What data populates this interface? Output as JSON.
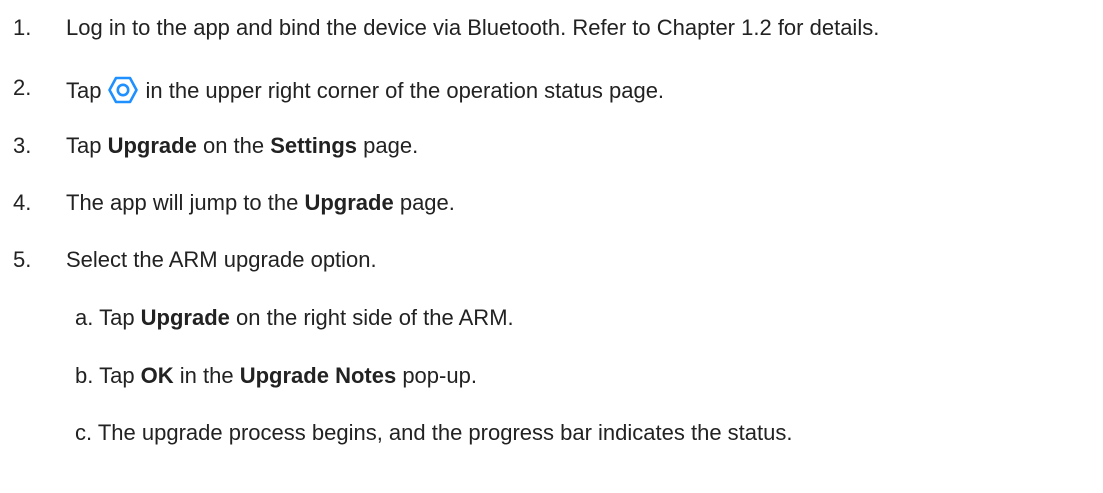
{
  "steps": [
    {
      "num": "1.",
      "text": "Log in to the app and bind the device via Bluetooth. Refer to Chapter 1.2 for details."
    },
    {
      "num": "2.",
      "before": "Tap",
      "icon": "settings-hexagon-icon",
      "after": "in the upper right corner of the operation status page."
    },
    {
      "num": "3.",
      "parts": [
        "Tap ",
        "Upgrade",
        " on the ",
        "Settings",
        " page."
      ]
    },
    {
      "num": "4.",
      "parts": [
        "The app will jump to the ",
        "Upgrade",
        " page."
      ]
    },
    {
      "num": "5.",
      "text": "Select the ARM upgrade option."
    }
  ],
  "substeps": [
    {
      "label": "a.",
      "parts": [
        "Tap ",
        "Upgrade",
        " on the right side of the ARM."
      ]
    },
    {
      "label": "b.",
      "parts": [
        "Tap ",
        "OK",
        " in the ",
        "Upgrade Notes",
        " pop-up."
      ]
    },
    {
      "label": "c.",
      "text": "The upgrade process begins, and the progress bar indicates the status."
    }
  ],
  "colors": {
    "text": "#222222",
    "icon": "#1e90ff"
  }
}
